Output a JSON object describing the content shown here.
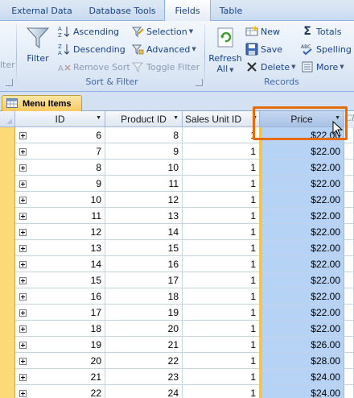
{
  "ribbon_tabs": [
    "External Data",
    "Database Tools",
    "Fields",
    "Table"
  ],
  "ribbon": {
    "partial_left_label": "lter",
    "filter_label": "Filter",
    "sort_filter": {
      "ascending": "Ascending",
      "descending": "Descending",
      "remove_sort": "Remove Sort",
      "selection": "Selection",
      "advanced": "Advanced",
      "toggle_filter": "Toggle Filter",
      "group_label": "Sort & Filter"
    },
    "records": {
      "refresh_line1": "Refresh",
      "refresh_line2": "All",
      "new": "New",
      "save": "Save",
      "delete": "Delete",
      "totals": "Totals",
      "spelling": "Spelling",
      "more": "More",
      "group_label": "Records"
    }
  },
  "document_tab": {
    "title": "Menu Items"
  },
  "table": {
    "headers": {
      "id": "ID",
      "product_id": "Product ID",
      "sales_unit_id": "Sales Unit ID",
      "price": "Price",
      "partial": "Cli"
    },
    "rows": [
      {
        "id": "6",
        "product_id": "8",
        "sales_unit_id": "1",
        "price": "$22.00"
      },
      {
        "id": "7",
        "product_id": "9",
        "sales_unit_id": "1",
        "price": "$22.00"
      },
      {
        "id": "8",
        "product_id": "10",
        "sales_unit_id": "1",
        "price": "$22.00"
      },
      {
        "id": "9",
        "product_id": "11",
        "sales_unit_id": "1",
        "price": "$22.00"
      },
      {
        "id": "10",
        "product_id": "12",
        "sales_unit_id": "1",
        "price": "$22.00"
      },
      {
        "id": "11",
        "product_id": "13",
        "sales_unit_id": "1",
        "price": "$22.00"
      },
      {
        "id": "12",
        "product_id": "14",
        "sales_unit_id": "1",
        "price": "$22.00"
      },
      {
        "id": "13",
        "product_id": "15",
        "sales_unit_id": "1",
        "price": "$22.00"
      },
      {
        "id": "14",
        "product_id": "16",
        "sales_unit_id": "1",
        "price": "$22.00"
      },
      {
        "id": "15",
        "product_id": "17",
        "sales_unit_id": "1",
        "price": "$22.00"
      },
      {
        "id": "16",
        "product_id": "18",
        "sales_unit_id": "1",
        "price": "$22.00"
      },
      {
        "id": "17",
        "product_id": "19",
        "sales_unit_id": "1",
        "price": "$22.00"
      },
      {
        "id": "18",
        "product_id": "20",
        "sales_unit_id": "1",
        "price": "$22.00"
      },
      {
        "id": "19",
        "product_id": "21",
        "sales_unit_id": "1",
        "price": "$26.00"
      },
      {
        "id": "20",
        "product_id": "22",
        "sales_unit_id": "1",
        "price": "$28.00"
      },
      {
        "id": "21",
        "product_id": "23",
        "sales_unit_id": "1",
        "price": "$24.00"
      },
      {
        "id": "22",
        "product_id": "24",
        "sales_unit_id": "1",
        "price": "$24.00"
      }
    ]
  },
  "colors": {
    "selected_column": "#b6d3f5",
    "callout_outline": "#e46c0a",
    "record_selector": "#fcda78"
  }
}
